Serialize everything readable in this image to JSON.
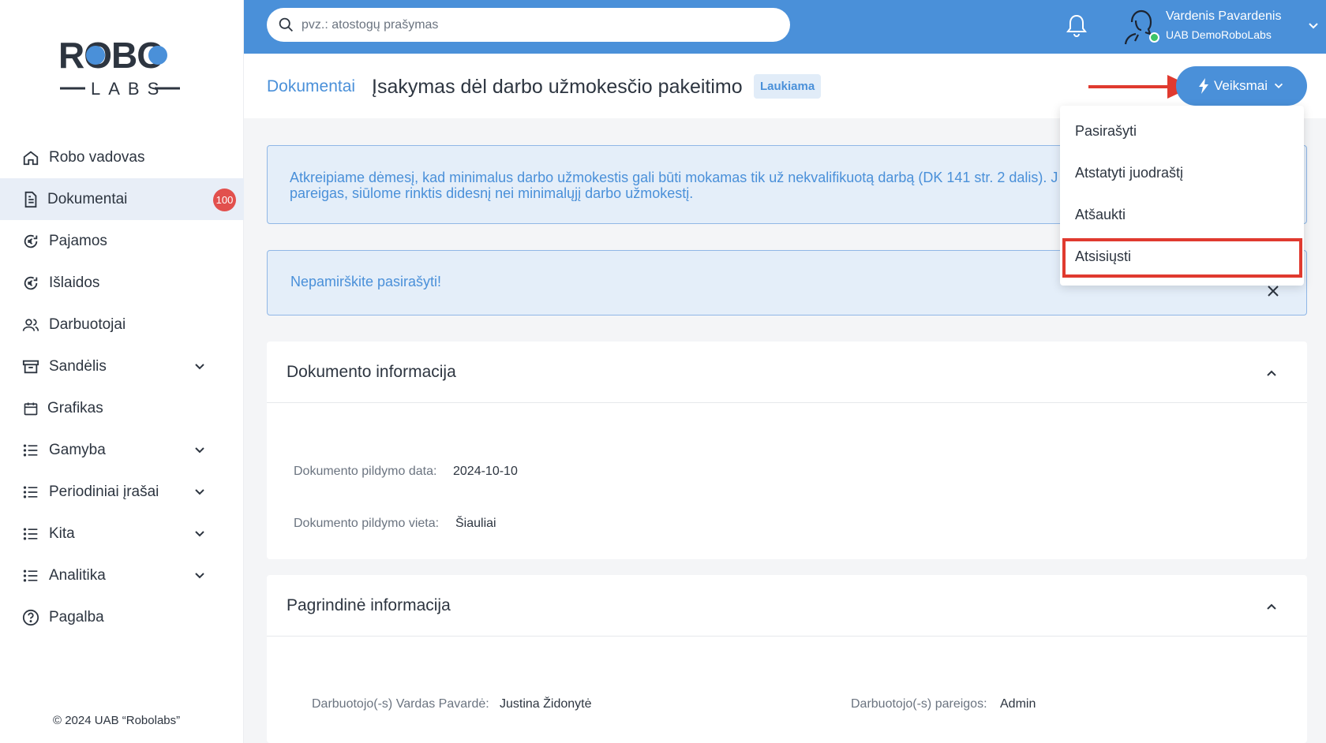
{
  "sidebar": {
    "logo_top": "ROBO",
    "logo_bottom": "LABS",
    "items": [
      {
        "label": "Robo vadovas",
        "icon": "home-icon"
      },
      {
        "label": "Dokumentai",
        "icon": "document-icon",
        "badge": "100"
      },
      {
        "label": "Pajamos",
        "icon": "euro-coin-icon"
      },
      {
        "label": "Išlaidos",
        "icon": "euro-coin-icon"
      },
      {
        "label": "Darbuotojai",
        "icon": "users-icon"
      },
      {
        "label": "Sandėlis",
        "icon": "archive-icon"
      },
      {
        "label": "Grafikas",
        "icon": "calendar-icon"
      },
      {
        "label": "Gamyba",
        "icon": "list-icon"
      },
      {
        "label": "Periodiniai įrašai",
        "icon": "list-icon"
      },
      {
        "label": "Kita",
        "icon": "list-icon"
      },
      {
        "label": "Analitika",
        "icon": "list-icon"
      },
      {
        "label": "Pagalba",
        "icon": "help-icon"
      }
    ],
    "copyright": "© 2024 UAB “Robolabs”"
  },
  "topbar": {
    "search_placeholder": "pvz.: atostogų prašymas",
    "user_name": "Vardenis Pavardenis",
    "user_company": "UAB DemoRoboLabs"
  },
  "header": {
    "breadcrumb": "Dokumentai",
    "title": "Įsakymas dėl darbo užmokesčio pakeitimo",
    "status": "Laukiama",
    "actions_label": "Veiksmai"
  },
  "dropdown": {
    "items": [
      "Pasirašyti",
      "Atstatyti juodraštį",
      "Atšaukti",
      "Atsisiųsti"
    ]
  },
  "alerts": {
    "info_line1": "Atkreipiame dėmesį, kad minimalus darbo užmokestis gali būti mokamas tik už nekvalifikuotą darbą (DK 141 str. 2 dalis). J",
    "info_line2": "pareigas, siūlome rinktis didesnį nei minimalųjį darbo užmokestį.",
    "reminder": "Nepamirškite pasirašyti!"
  },
  "doc_info": {
    "title": "Dokumento informacija",
    "date_label": "Dokumento pildymo data:",
    "date_value": "2024-10-10",
    "place_label": "Dokumento pildymo vieta:",
    "place_value": "Šiauliai"
  },
  "main_info": {
    "title": "Pagrindinė informacija",
    "employee_label": "Darbuotojo(-s) Vardas Pavardė:",
    "employee_value": "Justina Židonytė",
    "position_label": "Darbuotojo(-s) pareigos:",
    "position_value": "Admin"
  },
  "colors": {
    "accent": "#4a90d9",
    "badge": "#e2504d",
    "highlight": "#e03a2f",
    "online": "#3dc468"
  }
}
